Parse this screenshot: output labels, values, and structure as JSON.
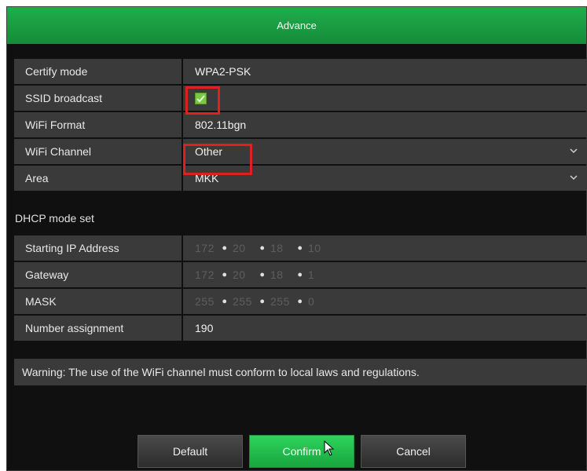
{
  "dialog": {
    "title": "Advance"
  },
  "settings": {
    "certify_mode": {
      "label": "Certify mode",
      "value": "WPA2-PSK"
    },
    "ssid_broadcast": {
      "label": "SSID broadcast",
      "checked": true
    },
    "wifi_format": {
      "label": "WiFi Format",
      "value": "802.11bgn"
    },
    "wifi_channel": {
      "label": "WiFi Channel",
      "value": "Other"
    },
    "area": {
      "label": "Area",
      "value": "MKK"
    }
  },
  "dhcp": {
    "section_label": "DHCP mode set",
    "starting_ip": {
      "label": "Starting IP Address",
      "octets": [
        "172",
        "20",
        "18",
        "10"
      ]
    },
    "gateway": {
      "label": "Gateway",
      "octets": [
        "172",
        "20",
        "18",
        "1"
      ]
    },
    "mask": {
      "label": "MASK",
      "octets": [
        "255",
        "255",
        "255",
        "0"
      ]
    },
    "number_assignment": {
      "label": "Number assignment",
      "value": "190"
    }
  },
  "warning": "Warning: The use of the WiFi channel must conform to local laws and regulations.",
  "buttons": {
    "default": "Default",
    "confirm": "Confirm",
    "cancel": "Cancel"
  },
  "colors": {
    "accent": "#1fae4c",
    "highlight": "#e01f1f",
    "checkbox": "#7ac943"
  }
}
